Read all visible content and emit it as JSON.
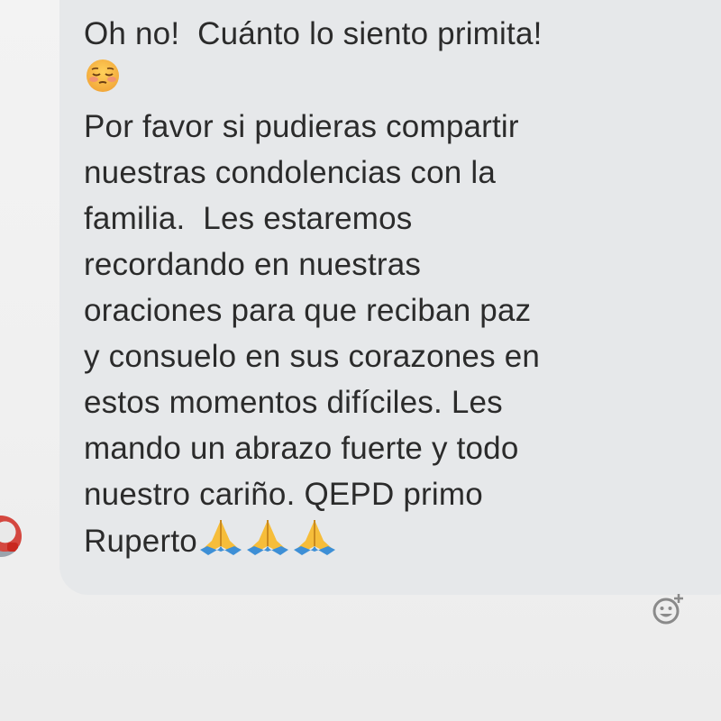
{
  "conversation": {
    "message": {
      "line1": "Oh no!  Cuánto lo siento primita!",
      "body": "Por favor si pudieras compartir\nnuestras condolencias con la\nfamilia.  Les estaremos\nrecordando en nuestras\noraciones para que reciban paz\ny consuelo en sus corazones en\nestos momentos difíciles. Les\nmando un abrazo fuerte y todo\nnuestro cariño. QEPD primo\n",
      "closing": "Ruperto",
      "emoji_after_line1": "pensive-face-emoji",
      "closing_emojis": [
        "folded-hands-emoji",
        "folded-hands-emoji",
        "folded-hands-emoji"
      ]
    },
    "reaction_button_icon": "add-reaction-icon",
    "colors": {
      "bubble": "#e6e8ea",
      "text": "#2b2b2b",
      "background": "#f2f2f2"
    }
  }
}
